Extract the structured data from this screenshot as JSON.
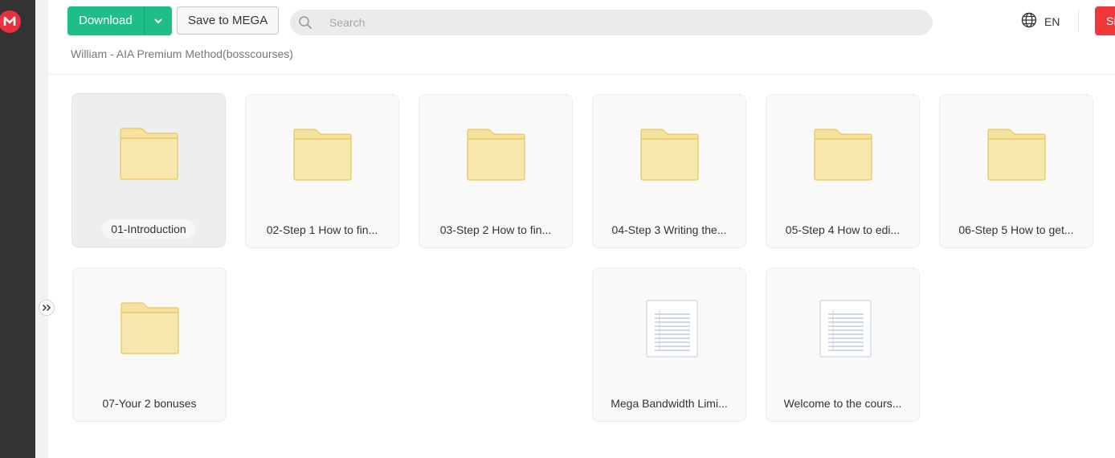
{
  "header": {
    "download_label": "Download",
    "save_label": "Save to MEGA",
    "search_placeholder": "Search",
    "language": "EN",
    "signup_label": "Si"
  },
  "breadcrumb": "William - AIA Premium Method(bosscourses)",
  "colors": {
    "accent_green": "#1fbe87",
    "brand_red": "#e9303d",
    "folder_fill": "#f8e7ad",
    "folder_stroke": "#e9c45f"
  },
  "items": [
    {
      "name": "01-Introduction",
      "type": "folder",
      "selected": true
    },
    {
      "name": "02-Step 1 How to fin...",
      "type": "folder"
    },
    {
      "name": "03-Step 2 How to fin...",
      "type": "folder"
    },
    {
      "name": "04-Step 3 Writing the...",
      "type": "folder"
    },
    {
      "name": "05-Step 4 How to edi...",
      "type": "folder"
    },
    {
      "name": "06-Step 5 How to get...",
      "type": "folder"
    },
    {
      "name": "07-Your 2 bonuses",
      "type": "folder"
    },
    {
      "name": "Mega Bandwidth Limi...",
      "type": "document"
    },
    {
      "name": "Welcome to the cours...",
      "type": "document"
    }
  ]
}
